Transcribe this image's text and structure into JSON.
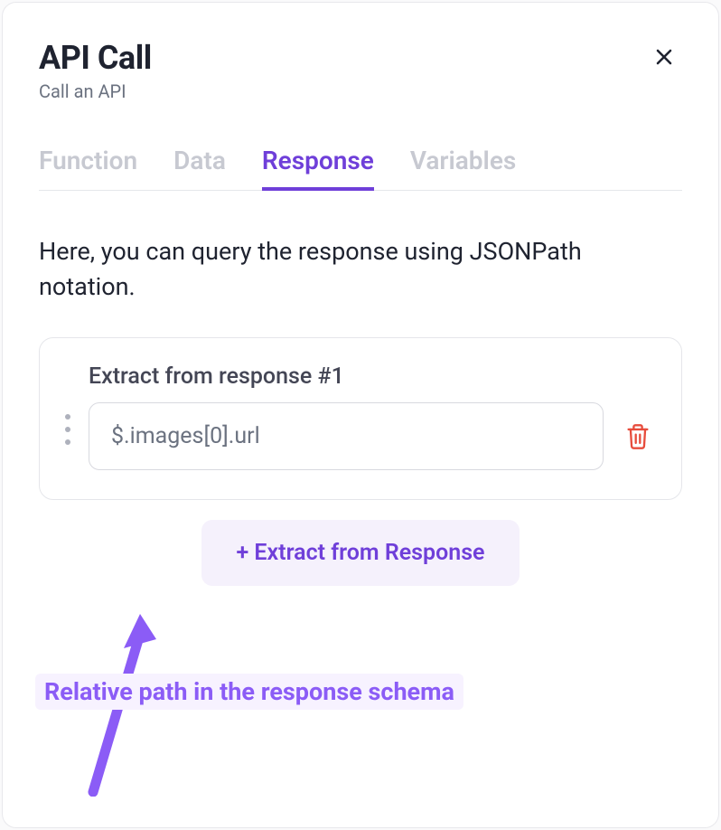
{
  "header": {
    "title": "API Call",
    "subtitle": "Call an API"
  },
  "tabs": [
    {
      "label": "Function",
      "active": false
    },
    {
      "label": "Data",
      "active": false
    },
    {
      "label": "Response",
      "active": true
    },
    {
      "label": "Variables",
      "active": false
    }
  ],
  "response": {
    "description": "Here, you can query the response using JSONPath notation.",
    "extracts": [
      {
        "label": "Extract from response #1",
        "value": "$.images[0].url"
      }
    ],
    "add_button_label": "+ Extract from Response"
  },
  "annotation": {
    "label": "Relative path in the response schema"
  }
}
